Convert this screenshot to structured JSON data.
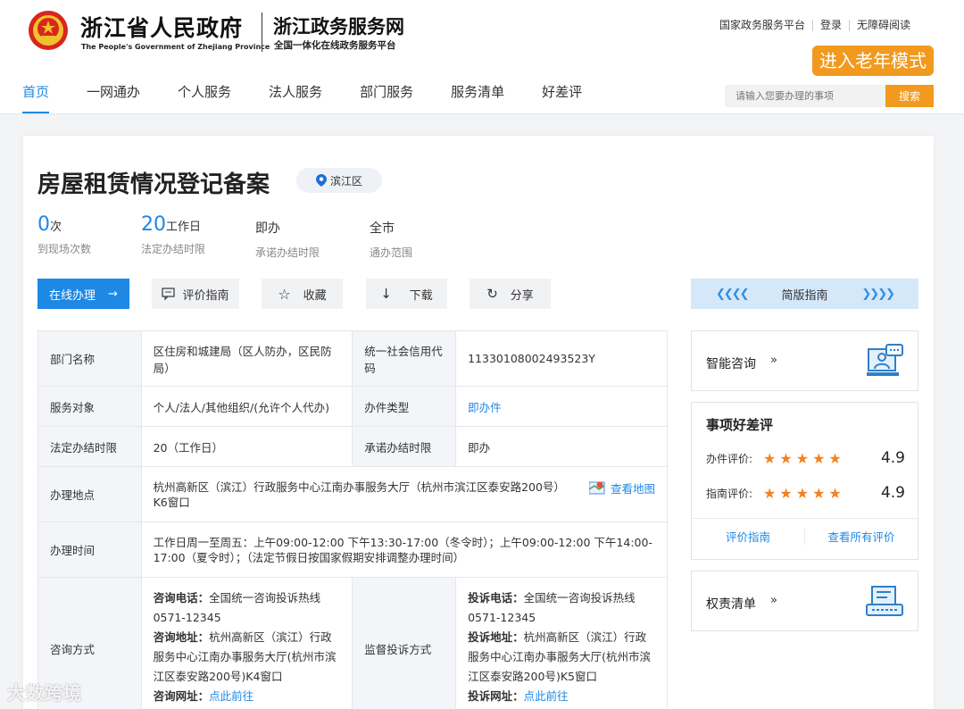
{
  "header": {
    "gov_name_cn": "浙江省人民政府",
    "gov_name_en": "The People's Government of Zhejiang Province",
    "site_name": "浙江政务服务网",
    "site_subtitle": "全国一体化在线政务服务平台",
    "top_links": [
      "国家政务服务平台",
      "登录",
      "无障碍阅读"
    ],
    "elder_mode": "进入老年模式",
    "nav": [
      "首页",
      "一网通办",
      "个人服务",
      "法人服务",
      "部门服务",
      "服务清单",
      "好差评"
    ],
    "search_placeholder": "请输入您要办理的事项",
    "search_button": "搜索"
  },
  "item": {
    "title": "房屋租赁情况登记备案",
    "region": "滨江区",
    "stats": [
      {
        "value": "0",
        "unit": "次",
        "label": "到现场次数"
      },
      {
        "value": "20",
        "unit": "工作日",
        "label": "法定办结时限"
      },
      {
        "value": "即办",
        "label": "承诺办结时限"
      },
      {
        "value": "全市",
        "label": "通办范围"
      }
    ],
    "buttons": {
      "online": "在线办理",
      "evaluate": "评价指南",
      "favorite": "收藏",
      "download": "下载",
      "share": "分享",
      "guide": "简版指南"
    }
  },
  "table": {
    "dept_label": "部门名称",
    "dept_value": "区住房和城建局（区人防办，区民防局）",
    "credit_label": "统一社会信用代码",
    "credit_value": "11330108002493523Y",
    "target_label": "服务对象",
    "target_value": "个人/法人/其他组织/(允许个人代办)",
    "type_label": "办件类型",
    "type_value": "即办件",
    "legal_label": "法定办结时限",
    "legal_value": "20（工作日）",
    "promise_label": "承诺办结时限",
    "promise_value": "即办",
    "location_label": "办理地点",
    "location_value": "杭州高新区（滨江）行政服务中心江南办事服务大厅（杭州市滨江区泰安路200号）K6窗口",
    "map_link": "查看地图",
    "time_label": "办理时间",
    "time_value": "工作日周一至周五：上午09:00-12:00 下午13:30-17:00（冬令时）；上午09:00-12:00 下午14:00-17:00（夏令时）；（法定节假日按国家假期安排调整办理时间）",
    "consult_label": "咨询方式",
    "consult_phone_label": "咨询电话：",
    "consult_phone": "全国统一咨询投诉热线0571-12345",
    "consult_addr_label": "咨询地址：",
    "consult_addr": "杭州高新区（滨江）行政服务中心江南办事服务大厅(杭州市滨江区泰安路200号)K4窗口",
    "consult_web_label": "咨询网址：",
    "consult_web": "点此前往",
    "supervise_label": "监督投诉方式",
    "complain_phone_label": "投诉电话：",
    "complain_phone": "全国统一咨询投诉热线0571-12345",
    "complain_addr_label": "投诉地址：",
    "complain_addr": "杭州高新区（滨江）行政服务中心江南办事服务大厅(杭州市滨江区泰安路200号)K5窗口",
    "complain_web_label": "投诉网址：",
    "complain_web": "点此前往"
  },
  "side": {
    "smart_consult": "智能咨询",
    "rating_title": "事项好差评",
    "ratings": [
      {
        "label": "办件评价:",
        "stars": 5,
        "score": "4.9"
      },
      {
        "label": "指南评价:",
        "stars": 5,
        "score": "4.9"
      }
    ],
    "rating_links": [
      "评价指南",
      "查看所有评价"
    ],
    "responsibility": "权责清单"
  },
  "watermark": "大数跨境",
  "colors": {
    "accent": "#1e88e5",
    "orange": "#f19a1e",
    "star": "#f5811f"
  }
}
